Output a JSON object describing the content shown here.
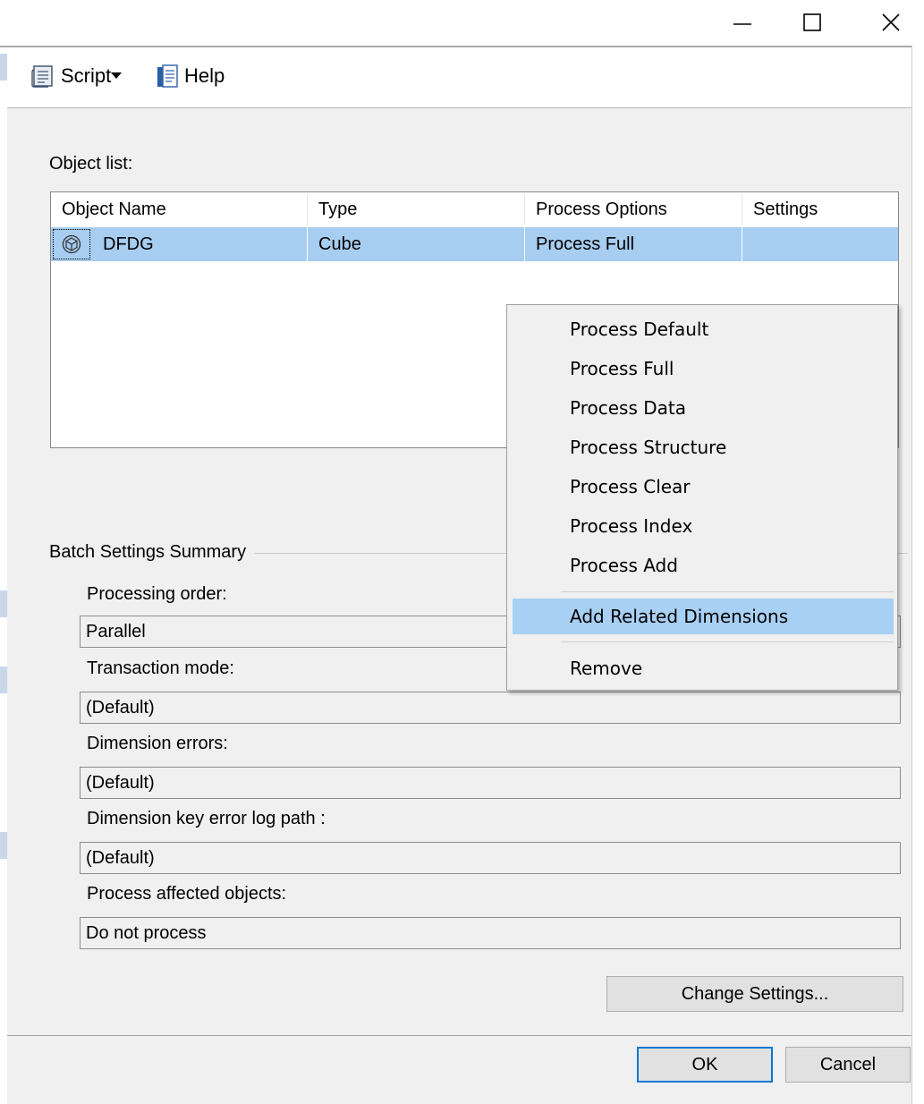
{
  "window": {
    "minimize_icon": "minimize-icon",
    "maximize_icon": "maximize-icon",
    "close_icon": "close-icon"
  },
  "toolbar": {
    "script_label": "Script",
    "help_label": "Help"
  },
  "object_list": {
    "label": "Object list:",
    "columns": [
      "Object Name",
      "Type",
      "Process Options",
      "Settings"
    ],
    "rows": [
      {
        "name": "DFDG",
        "type": "Cube",
        "process_options": "Process Full",
        "settings": "",
        "icon": "cube-icon",
        "selected": true
      }
    ]
  },
  "batch": {
    "title": "Batch Settings Summary",
    "processing_order_label": "Processing order:",
    "processing_order_value": "Parallel",
    "transaction_mode_label": "Transaction mode:",
    "transaction_mode_value": "(Default)",
    "dimension_errors_label": "Dimension errors:",
    "dimension_errors_value": "(Default)",
    "dimension_key_error_log_path_label": "Dimension key error log path :",
    "dimension_key_error_log_path_value": "(Default)",
    "process_affected_objects_label": "Process affected objects:",
    "process_affected_objects_value": "Do not process"
  },
  "buttons": {
    "change_settings": "Change Settings...",
    "ok": "OK",
    "cancel": "Cancel"
  },
  "context_menu": {
    "items": [
      "Process Default",
      "Process Full",
      "Process Data",
      "Process Structure",
      "Process Clear",
      "Process Index",
      "Process Add",
      "Add Related Dimensions",
      "Remove"
    ],
    "highlighted": "Add Related Dimensions"
  },
  "colors": {
    "selection": "#a7cdf0",
    "menu_highlight": "#a8d0f5",
    "default_button_border": "#0078d7",
    "panel_background": "#f0f0f0"
  }
}
